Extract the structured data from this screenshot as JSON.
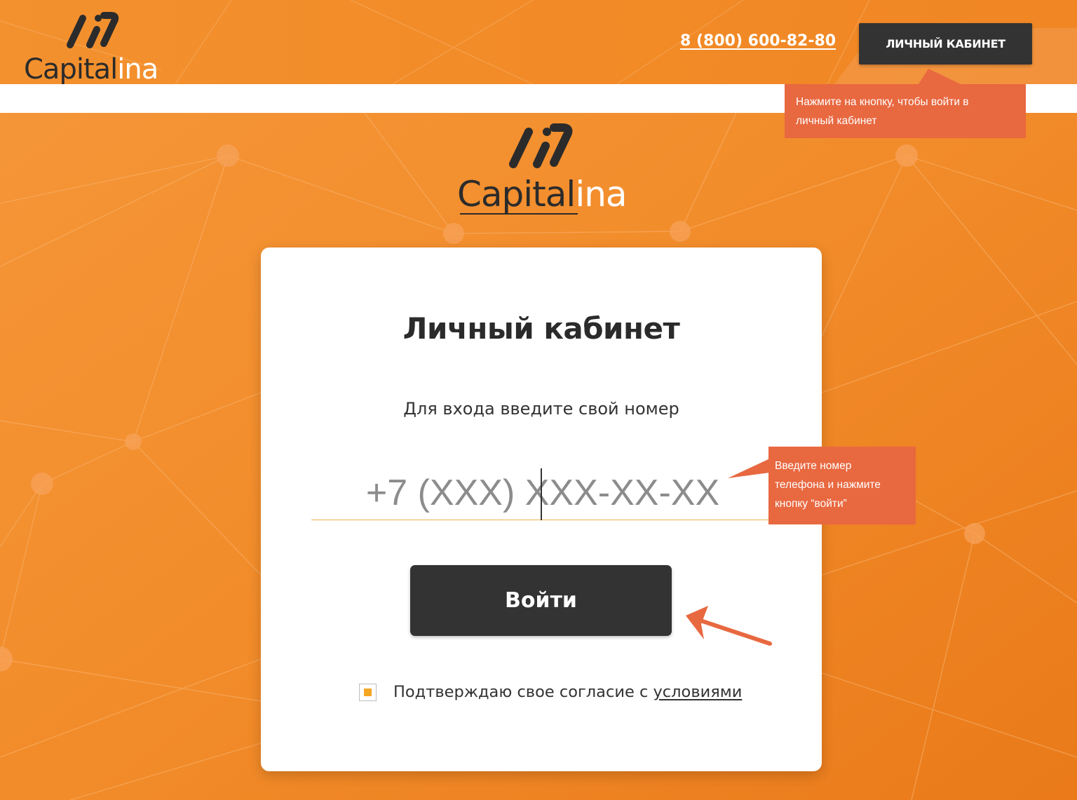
{
  "brand": {
    "logo_text_dark": "Capital",
    "logo_text_light": "ina",
    "primary_color": "#f08a24",
    "dark_color": "#333333",
    "callout_color": "#e86840",
    "accent_yellow": "#f5a623"
  },
  "header": {
    "phone": "8 (800) 600-82-80",
    "cabinet_button": "ЛИЧНЫЙ КАБИНЕТ"
  },
  "callouts": {
    "top": [
      "Нажмите на кнопку, чтобы войти в",
      "личный кабинет"
    ],
    "phone": [
      "Введите номер",
      "телефона и нажмите",
      "кнопку “войти”"
    ]
  },
  "login": {
    "title": "Личный кабинет",
    "subtitle": "Для входа введите свой номер",
    "phone_placeholder": "+7 (XXX) XXX-XX-XX",
    "phone_value": "",
    "submit_label": "Войти",
    "consent_text": "Подтверждаю свое согласие с ",
    "consent_link": "условиями",
    "consent_checked": true
  },
  "icons": {
    "logo_mark": "capitalina-logo-icon",
    "arrow": "arrow-pointer-icon"
  }
}
